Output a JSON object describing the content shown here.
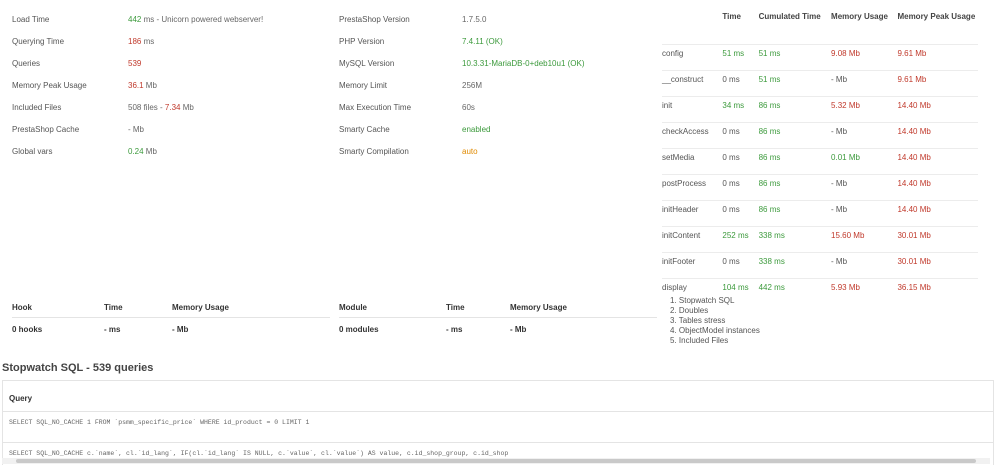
{
  "summary": {
    "load_time": {
      "label": "Load Time",
      "value": "442",
      "suffix": " ms - Unicorn powered webserver!"
    },
    "querying_time": {
      "label": "Querying Time",
      "value": "186",
      "suffix": " ms"
    },
    "queries": {
      "label": "Queries",
      "value": "539"
    },
    "memory_peak": {
      "label": "Memory Peak Usage",
      "value": "36.1",
      "suffix": " Mb"
    },
    "included_files": {
      "label": "Included Files",
      "prefix": "508 files - ",
      "value": "7.34",
      "suffix": " Mb"
    },
    "ps_cache": {
      "label": "PrestaShop Cache",
      "value": "- Mb"
    },
    "global_vars": {
      "label": "Global vars",
      "value": "0.24",
      "suffix": " Mb"
    }
  },
  "config": {
    "ps_version": {
      "label": "PrestaShop Version",
      "value": "1.7.5.0"
    },
    "php_version": {
      "label": "PHP Version",
      "value": "7.4.11 (OK)"
    },
    "mysql_version": {
      "label": "MySQL Version",
      "value": "10.3.31-MariaDB-0+deb10u1 (OK)"
    },
    "memory_limit": {
      "label": "Memory Limit",
      "value": "256M"
    },
    "max_exec": {
      "label": "Max Execution Time",
      "value": "60s"
    },
    "smarty_cache": {
      "label": "Smarty Cache",
      "value": "enabled"
    },
    "smarty_compilation": {
      "label": "Smarty Compilation",
      "value": "auto"
    }
  },
  "stages": {
    "headers": [
      "",
      "Time",
      "Cumulated Time",
      "Memory Usage",
      "Memory Peak Usage"
    ],
    "rows": [
      {
        "name": "config",
        "time": "51 ms",
        "cum": "51 ms",
        "mem": "9.08 Mb",
        "peak": "9.61 Mb"
      },
      {
        "name": "__construct",
        "time": "0 ms",
        "cum": "51 ms",
        "mem": "- Mb",
        "peak": "9.61 Mb"
      },
      {
        "name": "init",
        "time": "34 ms",
        "cum": "86 ms",
        "mem": "5.32 Mb",
        "peak": "14.40 Mb"
      },
      {
        "name": "checkAccess",
        "time": "0 ms",
        "cum": "86 ms",
        "mem": "- Mb",
        "peak": "14.40 Mb"
      },
      {
        "name": "setMedia",
        "time": "0 ms",
        "cum": "86 ms",
        "mem": "0.01 Mb",
        "peak": "14.40 Mb"
      },
      {
        "name": "postProcess",
        "time": "0 ms",
        "cum": "86 ms",
        "mem": "- Mb",
        "peak": "14.40 Mb"
      },
      {
        "name": "initHeader",
        "time": "0 ms",
        "cum": "86 ms",
        "mem": "- Mb",
        "peak": "14.40 Mb"
      },
      {
        "name": "initContent",
        "time": "252 ms",
        "cum": "338 ms",
        "mem": "15.60 Mb",
        "peak": "30.01 Mb"
      },
      {
        "name": "initFooter",
        "time": "0 ms",
        "cum": "338 ms",
        "mem": "- Mb",
        "peak": "30.01 Mb"
      },
      {
        "name": "display",
        "time": "104 ms",
        "cum": "442 ms",
        "mem": "5.93 Mb",
        "peak": "36.15 Mb"
      }
    ]
  },
  "hooks": {
    "headers": [
      "Hook",
      "Time",
      "Memory Usage"
    ],
    "total": [
      "0 hooks",
      "- ms",
      "- Mb"
    ]
  },
  "modules": {
    "headers": [
      "Module",
      "Time",
      "Memory Usage"
    ],
    "total": [
      "0 modules",
      "- ms",
      "- Mb"
    ]
  },
  "links": [
    "1. Stopwatch SQL",
    "2. Doubles",
    "3. Tables stress",
    "4. ObjectModel instances",
    "5. Included Files"
  ],
  "sql": {
    "title": "Stopwatch SQL - 539 queries",
    "column": "Query",
    "rows": [
      "SELECT SQL_NO_CACHE 1 FROM `psmm_specific_price` WHERE id_product = 0 LIMIT 1",
      "SELECT SQL_NO_CACHE c.`name`, cl.`id_lang`, IF(cl.`id_lang` IS NULL, c.`value`, cl.`value`) AS value, c.id_shop_group, c.id_shop"
    ]
  },
  "colors": {
    "good": "#3c9a3c",
    "bad": "#c0392b",
    "warn": "#e08a00"
  }
}
